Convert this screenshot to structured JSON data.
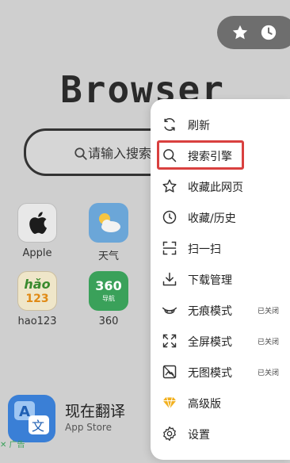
{
  "logo_text": "Browser",
  "search": {
    "placeholder": "请输入搜索"
  },
  "apps": [
    {
      "label": "Apple"
    },
    {
      "label": "天气"
    },
    {
      "label": "hao123",
      "icon_text_top": "hǎo",
      "icon_text_bottom": "123"
    },
    {
      "label": "360",
      "icon_text_top": "360",
      "icon_text_bottom": "导航"
    }
  ],
  "ad": {
    "title": "现在翻译",
    "subtitle": "App Store",
    "mark": "✕ 广告"
  },
  "menu": {
    "items": [
      {
        "label": "刷新",
        "icon": "refresh-icon"
      },
      {
        "label": "搜索引擎",
        "icon": "search-icon"
      },
      {
        "label": "收藏此网页",
        "icon": "star-icon"
      },
      {
        "label": "收藏/历史",
        "icon": "clock-icon"
      },
      {
        "label": "扫一扫",
        "icon": "scan-icon"
      },
      {
        "label": "下载管理",
        "icon": "download-icon"
      },
      {
        "label": "无痕模式",
        "icon": "incognito-icon",
        "status": "已关闭"
      },
      {
        "label": "全屏模式",
        "icon": "fullscreen-icon",
        "status": "已关闭"
      },
      {
        "label": "无图模式",
        "icon": "no-image-icon",
        "status": "已关闭"
      },
      {
        "label": "高级版",
        "icon": "diamond-icon"
      },
      {
        "label": "设置",
        "icon": "settings-icon"
      }
    ]
  },
  "colors": {
    "highlight": "#d9403f",
    "menu_bg": "#ffffff",
    "backdrop": "#cfcfcf",
    "diamond": "#f2b01e"
  }
}
